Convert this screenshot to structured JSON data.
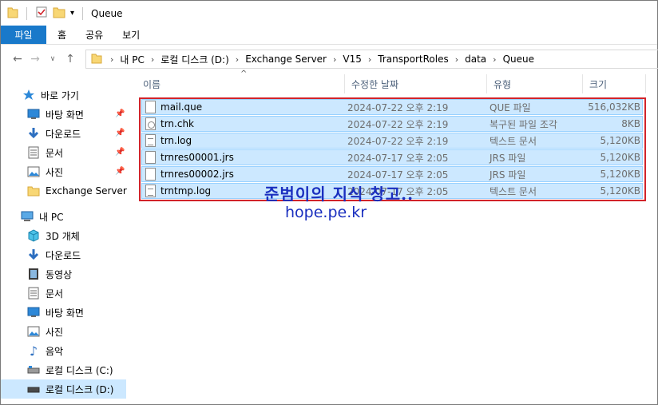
{
  "window": {
    "title": "Queue"
  },
  "ribbon": {
    "tabs": [
      "파일",
      "홈",
      "공유",
      "보기"
    ]
  },
  "address": {
    "crumbs": [
      "내 PC",
      "로컬 디스크 (D:)",
      "Exchange Server",
      "V15",
      "TransportRoles",
      "data",
      "Queue"
    ]
  },
  "nav": {
    "quick_access": "바로 가기",
    "pinned": [
      {
        "label": "바탕 화면",
        "icon": "desktop-icon",
        "pinned": true
      },
      {
        "label": "다운로드",
        "icon": "download-icon",
        "pinned": true
      },
      {
        "label": "문서",
        "icon": "document-icon",
        "pinned": true
      },
      {
        "label": "사진",
        "icon": "pictures-icon",
        "pinned": true
      },
      {
        "label": "Exchange Server",
        "icon": "folder-icon",
        "pinned": false
      }
    ],
    "this_pc": "내 PC",
    "pc_items": [
      {
        "label": "3D 개체",
        "icon": "3d-objects-icon"
      },
      {
        "label": "다운로드",
        "icon": "download-icon"
      },
      {
        "label": "동영상",
        "icon": "video-icon"
      },
      {
        "label": "문서",
        "icon": "document-icon"
      },
      {
        "label": "바탕 화면",
        "icon": "desktop-icon"
      },
      {
        "label": "사진",
        "icon": "pictures-icon"
      },
      {
        "label": "음악",
        "icon": "music-icon"
      },
      {
        "label": "로컬 디스크 (C:)",
        "icon": "drive-icon"
      },
      {
        "label": "로컬 디스크 (D:)",
        "icon": "drive-icon",
        "selected": true
      }
    ]
  },
  "columns": {
    "name": "이름",
    "date": "수정한 날짜",
    "type": "유형",
    "size": "크기"
  },
  "files": [
    {
      "name": "mail.que",
      "date": "2024-07-22 오후 2:19",
      "type": "QUE 파일",
      "size": "516,032KB",
      "icon": "file-icon"
    },
    {
      "name": "trn.chk",
      "date": "2024-07-22 오후 2:19",
      "type": "복구된 파일 조각",
      "size": "8KB",
      "icon": "chk-file-icon"
    },
    {
      "name": "trn.log",
      "date": "2024-07-22 오후 2:19",
      "type": "텍스트 문서",
      "size": "5,120KB",
      "icon": "text-file-icon"
    },
    {
      "name": "trnres00001.jrs",
      "date": "2024-07-17 오후 2:05",
      "type": "JRS 파일",
      "size": "5,120KB",
      "icon": "file-icon"
    },
    {
      "name": "trnres00002.jrs",
      "date": "2024-07-17 오후 2:05",
      "type": "JRS 파일",
      "size": "5,120KB",
      "icon": "file-icon"
    },
    {
      "name": "trntmp.log",
      "date": "2024-07-17 오후 2:05",
      "type": "텍스트 문서",
      "size": "5,120KB",
      "icon": "text-file-icon"
    }
  ],
  "watermark": {
    "line1": "준범이의 지식 창고..",
    "line2": "hope.pe.kr"
  },
  "colors": {
    "accent": "#1979ca",
    "selection": "#cce8ff",
    "highlight_box": "#d2232a",
    "watermark": "#1a2fbf"
  }
}
